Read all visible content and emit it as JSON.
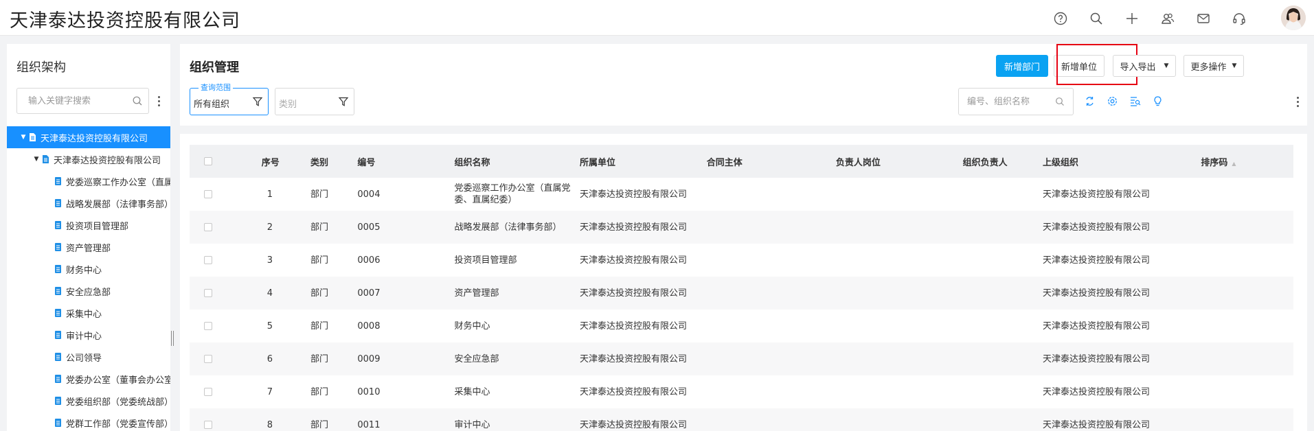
{
  "app": {
    "title": "天津泰达投资控股有限公司"
  },
  "topbar": {
    "icons": [
      "help-icon",
      "search-icon",
      "plus-icon",
      "users-icon",
      "mail-icon",
      "headset-icon"
    ]
  },
  "sidebar": {
    "title": "组织架构",
    "search_placeholder": "输入关键字搜索",
    "tree": [
      {
        "label": "天津泰达投资控股有限公司",
        "level": 0,
        "expanded": true,
        "selected": true
      },
      {
        "label": "天津泰达投资控股有限公司",
        "level": 1,
        "expanded": true
      },
      {
        "label": "党委巡察工作办公室（直属党委、直属纪委）",
        "level": 2
      },
      {
        "label": "战略发展部（法律事务部）",
        "level": 2
      },
      {
        "label": "投资项目管理部",
        "level": 2
      },
      {
        "label": "资产管理部",
        "level": 2
      },
      {
        "label": "财务中心",
        "level": 2
      },
      {
        "label": "安全应急部",
        "level": 2
      },
      {
        "label": "采集中心",
        "level": 2
      },
      {
        "label": "审计中心",
        "level": 2
      },
      {
        "label": "公司领导",
        "level": 2
      },
      {
        "label": "党委办公室（董事会办公室）",
        "level": 2
      },
      {
        "label": "党委组织部（党委统战部）",
        "level": 2
      },
      {
        "label": "党群工作部（党委宣传部）",
        "level": 2
      }
    ]
  },
  "main": {
    "title": "组织管理",
    "buttons": {
      "add_dept": "新增部门",
      "add_unit": "新增单位",
      "import_export": "导入导出",
      "more_ops": "更多操作"
    },
    "filters": {
      "scope_label": "查询范围",
      "scope_value": "所有组织",
      "category_placeholder": "类别"
    },
    "code_search_placeholder": "编号、组织名称",
    "toolbar_icons": [
      "refresh-icon",
      "settings-icon",
      "filter-list-icon",
      "lightbulb-icon"
    ],
    "table": {
      "columns": [
        "序号",
        "类别",
        "编号",
        "组织名称",
        "所属单位",
        "合同主体",
        "负责人岗位",
        "组织负责人",
        "上级组织",
        "排序码"
      ],
      "rows": [
        {
          "no": "1",
          "type": "部门",
          "code": "0004",
          "name": "党委巡察工作办公室（直属党委、直属纪委）",
          "unit": "天津泰达投资控股有限公司",
          "contract": "",
          "post": "",
          "leader": "",
          "parent": "天津泰达投资控股有限公司",
          "sort": ""
        },
        {
          "no": "2",
          "type": "部门",
          "code": "0005",
          "name": "战略发展部（法律事务部）",
          "unit": "天津泰达投资控股有限公司",
          "contract": "",
          "post": "",
          "leader": "",
          "parent": "天津泰达投资控股有限公司",
          "sort": ""
        },
        {
          "no": "3",
          "type": "部门",
          "code": "0006",
          "name": "投资项目管理部",
          "unit": "天津泰达投资控股有限公司",
          "contract": "",
          "post": "",
          "leader": "",
          "parent": "天津泰达投资控股有限公司",
          "sort": ""
        },
        {
          "no": "4",
          "type": "部门",
          "code": "0007",
          "name": "资产管理部",
          "unit": "天津泰达投资控股有限公司",
          "contract": "",
          "post": "",
          "leader": "",
          "parent": "天津泰达投资控股有限公司",
          "sort": ""
        },
        {
          "no": "5",
          "type": "部门",
          "code": "0008",
          "name": "财务中心",
          "unit": "天津泰达投资控股有限公司",
          "contract": "",
          "post": "",
          "leader": "",
          "parent": "天津泰达投资控股有限公司",
          "sort": ""
        },
        {
          "no": "6",
          "type": "部门",
          "code": "0009",
          "name": "安全应急部",
          "unit": "天津泰达投资控股有限公司",
          "contract": "",
          "post": "",
          "leader": "",
          "parent": "天津泰达投资控股有限公司",
          "sort": ""
        },
        {
          "no": "7",
          "type": "部门",
          "code": "0010",
          "name": "采集中心",
          "unit": "天津泰达投资控股有限公司",
          "contract": "",
          "post": "",
          "leader": "",
          "parent": "天津泰达投资控股有限公司",
          "sort": ""
        },
        {
          "no": "8",
          "type": "部门",
          "code": "0011",
          "name": "审计中心",
          "unit": "天津泰达投资控股有限公司",
          "contract": "",
          "post": "",
          "leader": "",
          "parent": "天津泰达投资控股有限公司",
          "sort": ""
        }
      ]
    }
  },
  "colors": {
    "primary": "#0aa2f2",
    "selected_tree": "#1890ff",
    "highlight_box": "#e60012"
  }
}
